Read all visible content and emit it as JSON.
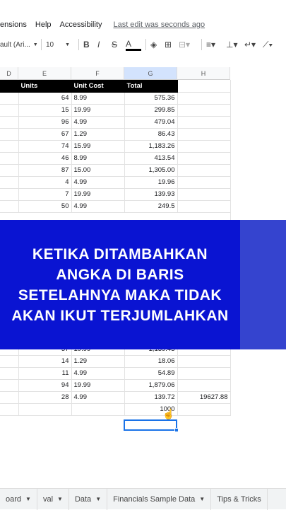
{
  "menu": {
    "items": [
      "ensions",
      "Help",
      "Accessibility"
    ],
    "last_edit": "Last edit was seconds ago"
  },
  "toolbar": {
    "font": "ault (Ari...",
    "font_size": "10",
    "bold": "B",
    "italic": "I",
    "strike": "S",
    "textcolor": "A"
  },
  "columns": [
    "D",
    "E",
    "F",
    "G",
    "H"
  ],
  "header_row": {
    "d": "",
    "e": "Units",
    "f": "Unit Cost",
    "g": "Total",
    "h": ""
  },
  "rows_top": [
    {
      "e": "64",
      "f": "8.99",
      "g": "575.36"
    },
    {
      "e": "15",
      "f": "19.99",
      "g": "299.85"
    },
    {
      "e": "96",
      "f": "4.99",
      "g": "479.04"
    },
    {
      "e": "67",
      "f": "1.29",
      "g": "86.43"
    },
    {
      "e": "74",
      "f": "15.99",
      "g": "1,183.26"
    },
    {
      "e": "46",
      "f": "8.99",
      "g": "413.54"
    },
    {
      "e": "87",
      "f": "15.00",
      "g": "1,305.00"
    },
    {
      "e": "4",
      "f": "4.99",
      "g": "19.96"
    },
    {
      "e": "7",
      "f": "19.99",
      "g": "139.93"
    },
    {
      "e": "50",
      "f": "4.99",
      "g": "249.5"
    }
  ],
  "rows_bottom": [
    {
      "e": "57",
      "f": "19.99",
      "g": "1,139.43",
      "h": ""
    },
    {
      "e": "14",
      "f": "1.29",
      "g": "18.06",
      "h": ""
    },
    {
      "e": "11",
      "f": "4.99",
      "g": "54.89",
      "h": ""
    },
    {
      "e": "94",
      "f": "19.99",
      "g": "1,879.06",
      "h": ""
    },
    {
      "e": "28",
      "f": "4.99",
      "g": "139.72",
      "h": "19627.88"
    },
    {
      "e": "",
      "f": "",
      "g": "1000",
      "h": ""
    }
  ],
  "banner": {
    "text": "KETIKA DITAMBAHKAN ANGKA DI BARIS SETELAHNYA MAKA TIDAK AKAN IKUT TERJUMLAHKAN"
  },
  "tabs": [
    "oard",
    "val",
    "Data",
    "Financials Sample Data",
    "Tips & Tricks"
  ]
}
